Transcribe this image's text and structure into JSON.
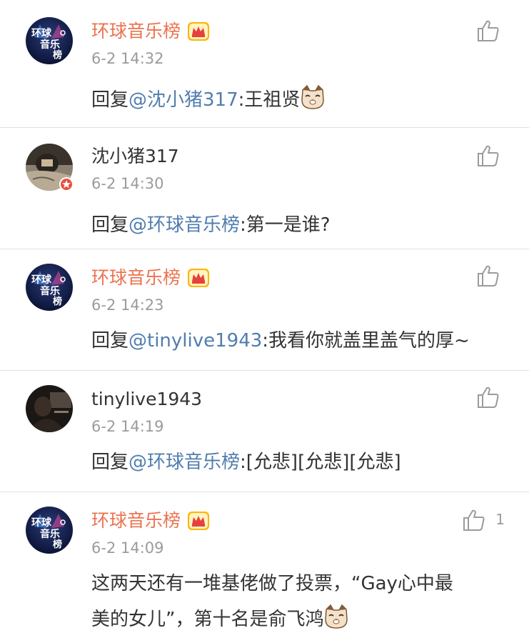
{
  "comments": [
    {
      "name": "环球音乐榜",
      "time": "6-2 14:32",
      "reply_prefix": "回复",
      "mention": "@沈小猪317",
      "body": ":王祖贤",
      "like_count": ""
    },
    {
      "name": "沈小猪317",
      "time": "6-2 14:30",
      "reply_prefix": "回复",
      "mention": "@环球音乐榜",
      "body": ":第一是谁?",
      "like_count": ""
    },
    {
      "name": "环球音乐榜",
      "time": "6-2 14:23",
      "reply_prefix": "回复",
      "mention": "@tinylive1943",
      "body": ":我看你就盖里盖气的厚~",
      "like_count": ""
    },
    {
      "name": "tinylive1943",
      "time": "6-2 14:19",
      "reply_prefix": "回复",
      "mention": "@环球音乐榜",
      "body": ":[允悲][允悲][允悲]",
      "like_count": ""
    },
    {
      "name": "环球音乐榜",
      "time": "6-2 14:09",
      "body_line1": "这两天还有一堆基佬做了投票，“Gay心中最",
      "body_line2": "美的女儿”，第十名是俞飞鸿",
      "like_count": "1"
    }
  ],
  "avatar_logo": {
    "line1": "环球",
    "line2": "音乐",
    "line3": "榜"
  },
  "colors": {
    "vip_name": "#eb7350",
    "mention": "#507daf",
    "time": "#9b9b9b",
    "text": "#333333",
    "divider": "#e2e2e2"
  },
  "icons": {
    "like": "thumbs-up-icon",
    "crown": "vip-crown-icon",
    "emoji": "cat-face-emoji-icon"
  }
}
